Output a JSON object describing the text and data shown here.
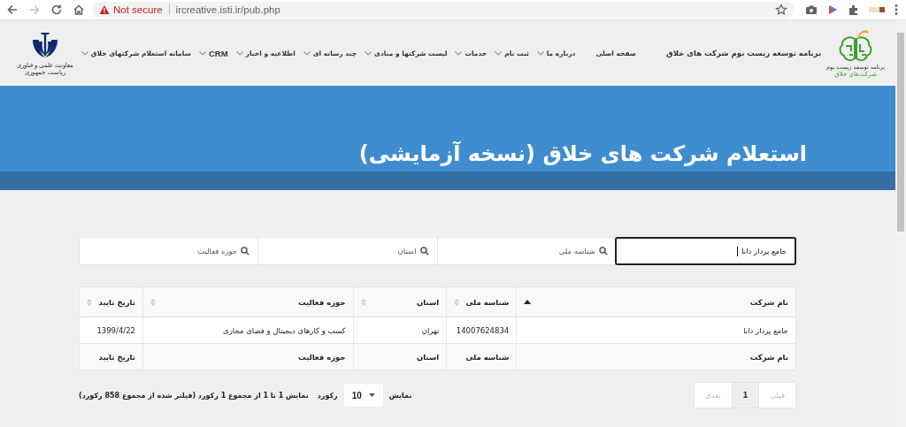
{
  "browser": {
    "warning": "Not secure",
    "url": "ircreative.isti.ir/pub.php"
  },
  "header": {
    "brand_title": "برنامه توسعه زیست بوم شرکت های خلاق",
    "logo_caption": [
      "برنامه توسعه زیست بوم",
      "شرکت‌های خلاق"
    ],
    "emblem_caption": "معاونت علمی و فناوری ریاست جمهوری",
    "menu": [
      {
        "label": "صفحه اصلی",
        "dropdown": false,
        "bold": false
      },
      {
        "label": "درباره ما",
        "dropdown": true,
        "bold": false
      },
      {
        "label": "ثبت نام",
        "dropdown": true,
        "bold": false
      },
      {
        "label": "خدمات",
        "dropdown": true,
        "bold": false
      },
      {
        "label": "لیست شرکتها و مبادی",
        "dropdown": true,
        "bold": false
      },
      {
        "label": "چند رسانه ای",
        "dropdown": true,
        "bold": false
      },
      {
        "label": "اطلاعیه و اخبار",
        "dropdown": true,
        "bold": false
      },
      {
        "label": "CRM",
        "dropdown": true,
        "bold": true
      },
      {
        "label": "سامانه استعلام شرکتهای خلاق",
        "dropdown": true,
        "bold": false
      }
    ]
  },
  "banner": {
    "title": "استعلام شرکت های خلاق (نسخه آزمایشی)"
  },
  "filters": [
    {
      "value": "جامع پرداز دانا",
      "focused": true
    },
    {
      "placeholder": "شناسه ملی",
      "focused": false
    },
    {
      "placeholder": "استان",
      "focused": false
    },
    {
      "placeholder": "حوزه فعالیت",
      "focused": false
    }
  ],
  "table": {
    "columns": [
      {
        "label": "نام شرکت",
        "sorted": true
      },
      {
        "label": "شناسه ملی",
        "sorted": false
      },
      {
        "label": "استان",
        "sorted": false
      },
      {
        "label": "حوزه فعالیت",
        "sorted": false
      },
      {
        "label": "تاریخ تایید",
        "sorted": false
      }
    ],
    "rows": [
      [
        "جامع پرداز دانا",
        "14007624834",
        "تهران",
        "کسب و کارهای دیجیتال و فضای مجازی",
        "1399/4/22"
      ]
    ],
    "footer": [
      "نام شرکت",
      "شناسه ملی",
      "استان",
      "حوزه فعالیت",
      "تاریخ تایید"
    ]
  },
  "page_length": {
    "before": "نمایش",
    "value": "10",
    "after": "رکورد"
  },
  "info": "نمایش 1 تا 1 از مجموع 1 رکورد (فیلتر شده از مجموع 858 رکورد)",
  "pagination": [
    {
      "label": "قبلی",
      "selected": false,
      "disabled": true
    },
    {
      "label": "1",
      "selected": true,
      "disabled": false
    },
    {
      "label": "بعدی",
      "selected": false,
      "disabled": true
    }
  ]
}
